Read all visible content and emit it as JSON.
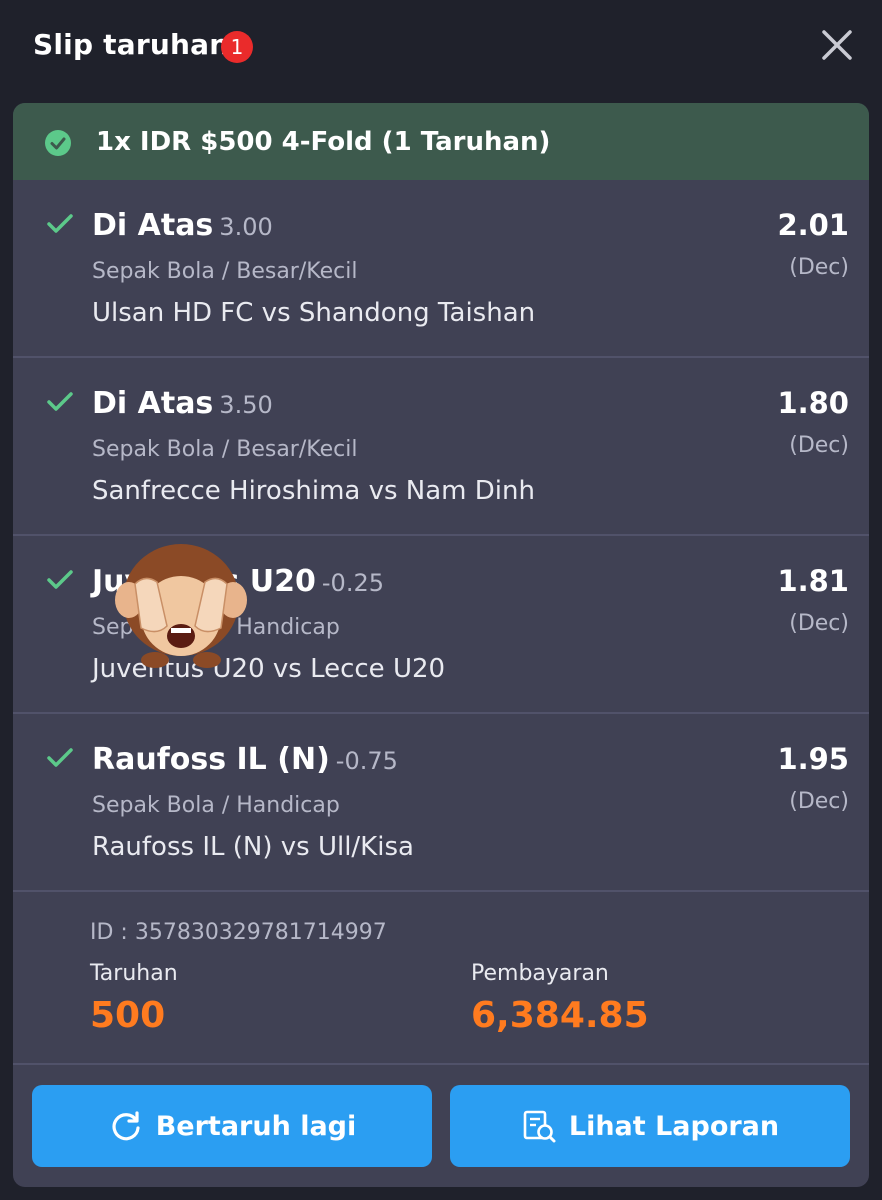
{
  "header": {
    "title": "Slip taruhan",
    "badge": "1",
    "close_icon": "close-icon"
  },
  "summary": {
    "icon": "check-circle-icon",
    "text": "1x IDR $500 4-Fold (1 Taruhan)"
  },
  "bets": [
    {
      "selection": "Di Atas",
      "handicap": "3.00",
      "market": "Sepak Bola / Besar/Kecil",
      "match": "Ulsan HD FC vs Shandong Taishan",
      "odds": "2.01",
      "odds_type": "(Dec)"
    },
    {
      "selection": "Di Atas",
      "handicap": "3.50",
      "market": "Sepak Bola / Besar/Kecil",
      "match": "Sanfrecce Hiroshima vs Nam Dinh",
      "odds": "1.80",
      "odds_type": "(Dec)"
    },
    {
      "selection": "Juventus U20",
      "handicap": "-0.25",
      "market": "Sepak Bola / Handicap",
      "match": "Juventus U20 vs Lecce U20",
      "odds": "1.81",
      "odds_type": "(Dec)"
    },
    {
      "selection": "Raufoss IL (N)",
      "handicap": "-0.75",
      "market": "Sepak Bola / Handicap",
      "match": "Raufoss IL (N) vs Ull/Kisa",
      "odds": "1.95",
      "odds_type": "(Dec)"
    }
  ],
  "info": {
    "id": "ID : 357830329781714997",
    "stake_label": "Taruhan",
    "stake_value": "500",
    "payout_label": "Pembayaran",
    "payout_value": "6,384.85"
  },
  "buttons": {
    "rebet_label": "Bertaruh lagi",
    "rebet_icon": "refresh-icon",
    "report_label": "Lihat Laporan",
    "report_icon": "report-search-icon"
  },
  "overlay": {
    "icon": "see-no-evil-monkey-icon"
  },
  "colors": {
    "background": "#1f212b",
    "card": "#404154",
    "summary_bg": "#3d5a4d",
    "check": "#5cc98a",
    "accent_orange": "#ff7b1f",
    "button_blue": "#2b9ef2",
    "badge_red": "#ea2b2b"
  }
}
